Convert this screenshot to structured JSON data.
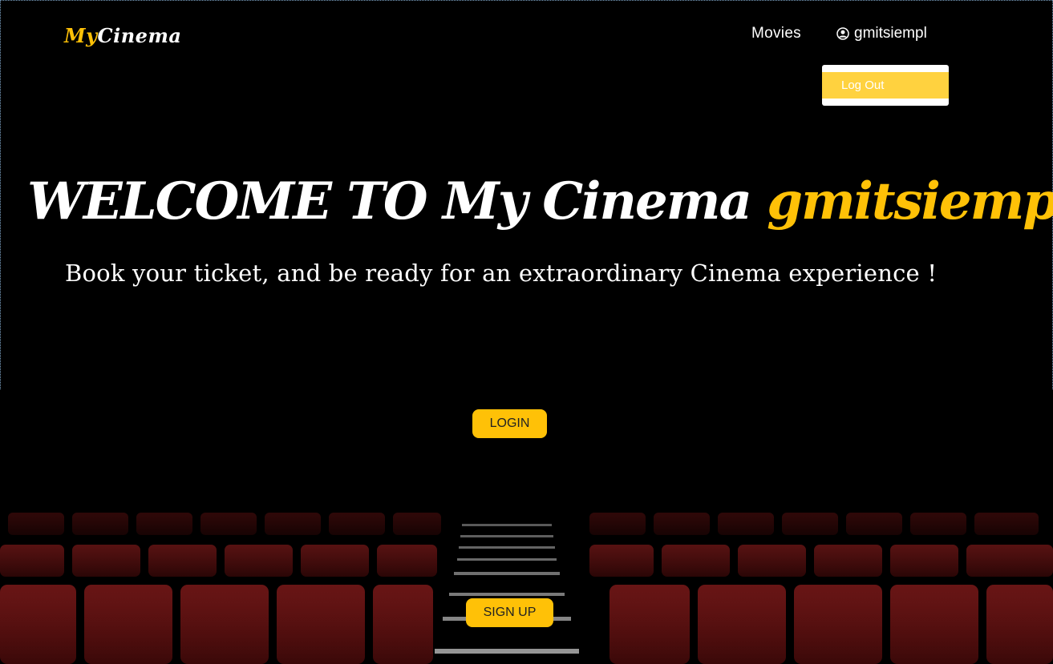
{
  "brand": {
    "logo_part1": "My",
    "logo_part2": "Cinema"
  },
  "nav": {
    "movies_label": "Movies",
    "user_label": "gmitsiempl",
    "user_icon": "user-circle-icon"
  },
  "dropdown": {
    "logout_label": "Log Out"
  },
  "hero": {
    "title_prefix": "WELCOME TO My Cinema",
    "title_username": "gmitsiempl",
    "title_suffix": "! ! !",
    "subtitle": "Book your ticket, and be ready for an extraordinary Cinema experience !"
  },
  "buttons": {
    "login_label": "LOGIN",
    "signup_label": "SIGN UP"
  },
  "colors": {
    "accent": "#ffc107",
    "dropdown_item": "#ffd23f",
    "background": "#000000",
    "seat": "#6b1414"
  }
}
